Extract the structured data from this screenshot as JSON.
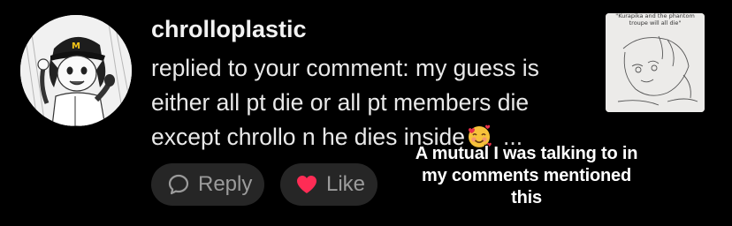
{
  "notification": {
    "username": "chrolloplastic",
    "message_lines": [
      "replied to your comment: my guess is",
      "either all pt die or all pt members die",
      "except chrollo n he dies inside"
    ],
    "emoji": "smiling-face-with-hearts",
    "truncation": "..."
  },
  "actions": {
    "reply_label": "Reply",
    "like_label": "Like",
    "reply_icon": "speech-bubble-icon",
    "like_icon": "heart-icon",
    "like_color": "#fe2c55"
  },
  "thumbnail": {
    "caption": "\"Kurapika and the phantom troupe will all die\""
  },
  "overlay": {
    "lines": [
      "A mutual I was talking to in",
      "my comments mentioned",
      "this"
    ]
  }
}
